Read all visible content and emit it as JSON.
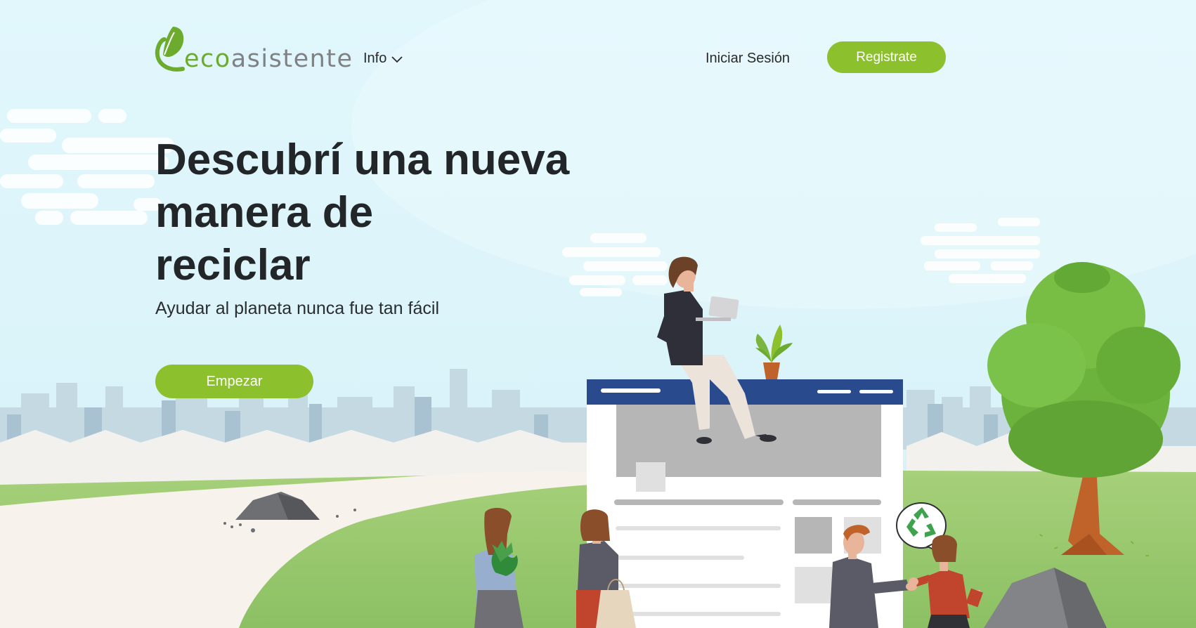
{
  "brand": {
    "logo_part1": "eco",
    "logo_part2": "asistente",
    "green": "#6cab2e",
    "gray": "#7f8284"
  },
  "nav": {
    "info_label": "Info",
    "login_label": "Iniciar Sesión",
    "register_label": "Registrate"
  },
  "hero": {
    "title_line1": "Descubrí una nueva",
    "title_line2": "manera de",
    "title_line3": "reciclar",
    "subtitle": "Ayudar al planeta nunca fue tan fácil",
    "cta_label": "Empezar"
  },
  "colors": {
    "accent": "#8cc12d",
    "sky": "#dff6fb",
    "title": "#222628",
    "window_header": "#2a4a8e"
  },
  "illustration": {
    "icons": [
      "leaf-icon",
      "chevron-down-icon",
      "recycle-icon",
      "laptop-icon",
      "plant-icon"
    ]
  }
}
